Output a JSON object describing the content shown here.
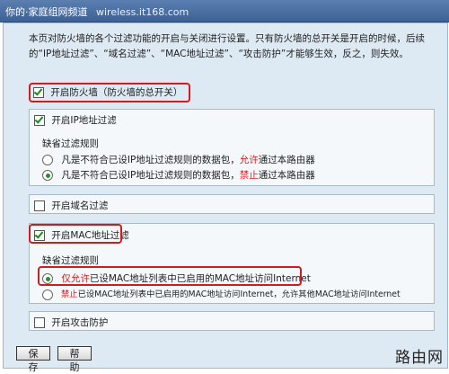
{
  "header": {
    "title": "你的·家庭组网频道",
    "url": "wireless.it168.com"
  },
  "description": "本页对防火墙的各个过滤功能的开启与关闭进行设置。只有防火墙的总开关是开启的时候，后续的“IP地址过滤”、“域名过滤”、“MAC地址过滤”、“攻击防护”才能够生效，反之，则失效。",
  "firewall": {
    "label": "开启防火墙（防火墙的总开关）",
    "checked": true
  },
  "ip_filter": {
    "label": "开启IP地址过滤",
    "checked": true,
    "rule_title": "缺省过滤规则",
    "options": [
      {
        "pre": "凡是不符合已设IP地址过滤规则的数据包，",
        "hl": "允许",
        "post": "通过本路由器",
        "selected": false
      },
      {
        "pre": "凡是不符合已设IP地址过滤规则的数据包，",
        "hl": "禁止",
        "post": "通过本路由器",
        "selected": true
      }
    ]
  },
  "domain_filter": {
    "label": "开启域名过滤",
    "checked": false
  },
  "mac_filter": {
    "label": "开启MAC地址过滤",
    "checked": true,
    "rule_title": "缺省过滤规则",
    "options": [
      {
        "pre": "",
        "hl": "仅允许",
        "post": "已设MAC地址列表中已启用的MAC地址访问Internet",
        "selected": true
      },
      {
        "pre": "",
        "hl": "禁止",
        "post": "已设MAC地址列表中已启用的MAC地址访问Internet，允许其他MAC地址访问Internet",
        "selected": false
      }
    ]
  },
  "attack_protection": {
    "label": "开启攻击防护",
    "checked": false
  },
  "buttons": {
    "save": "保 存",
    "help": "帮 助"
  },
  "watermark": "路由网"
}
